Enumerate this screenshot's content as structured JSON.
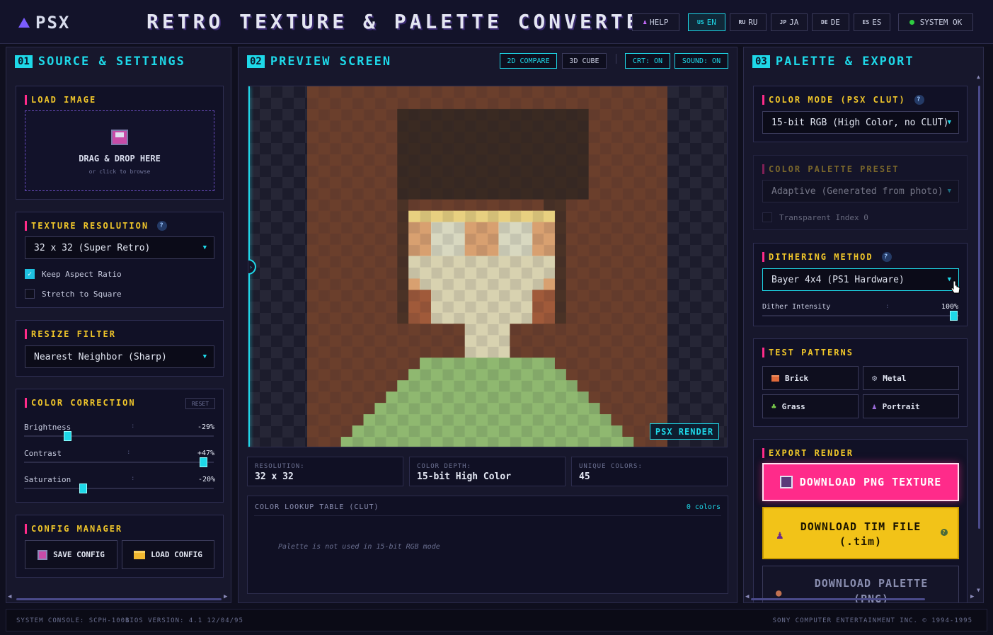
{
  "header": {
    "logo": "PSX",
    "title": "RETRO TEXTURE & PALETTE CONVERTER",
    "help": "HELP",
    "languages": [
      {
        "flag": "US",
        "label": "EN",
        "active": true
      },
      {
        "flag": "RU",
        "label": "RU",
        "active": false
      },
      {
        "flag": "JP",
        "label": "JA",
        "active": false
      },
      {
        "flag": "DE",
        "label": "DE",
        "active": false
      },
      {
        "flag": "ES",
        "label": "ES",
        "active": false
      }
    ],
    "status": "SYSTEM OK"
  },
  "source": {
    "num": "01",
    "title": "SOURCE & SETTINGS",
    "load": {
      "title": "LOAD IMAGE",
      "drop": "DRAG & DROP HERE",
      "hint": "or click to browse"
    },
    "resolution": {
      "title": "TEXTURE RESOLUTION",
      "value": "32 x 32 (Super Retro)",
      "keep_aspect": "Keep Aspect Ratio",
      "keep_aspect_checked": true,
      "stretch": "Stretch to Square",
      "stretch_checked": false
    },
    "filter": {
      "title": "RESIZE FILTER",
      "value": "Nearest Neighbor (Sharp)"
    },
    "correction": {
      "title": "COLOR CORRECTION",
      "reset": "RESET",
      "sliders": [
        {
          "label": "Brightness",
          "sep": ":",
          "value": "-29%",
          "level": -0.29
        },
        {
          "label": "Contrast",
          "sep": ":",
          "value": "+47%",
          "level": 0.47
        },
        {
          "label": "Saturation",
          "sep": ":",
          "value": "-20%",
          "level": -0.2
        }
      ]
    },
    "config": {
      "title": "CONFIG MANAGER",
      "save": "SAVE CONFIG",
      "load": "LOAD CONFIG"
    }
  },
  "preview": {
    "num": "02",
    "title": "PREVIEW SCREEN",
    "buttons": {
      "compare": "2D COMPARE",
      "cube": "3D CUBE",
      "crt": "CRT: ON",
      "sound": "SOUND: ON"
    },
    "badge": "PSX RENDER",
    "stats": [
      {
        "key": "RESOLUTION:",
        "value": "32 x 32"
      },
      {
        "key": "COLOR DEPTH:",
        "value": "15-bit High Color"
      },
      {
        "key": "UNIQUE COLORS:",
        "value": "45"
      }
    ],
    "clut": {
      "title": "COLOR LOOKUP TABLE (CLUT)",
      "count": "0 colors",
      "note": "Palette is not used in 15-bit RGB mode"
    }
  },
  "palette": {
    "num": "03",
    "title": "PALETTE & EXPORT",
    "mode": {
      "title": "COLOR MODE (PSX CLUT)",
      "value": "15-bit RGB (High Color, no CLUT)"
    },
    "preset": {
      "title": "COLOR PALETTE PRESET",
      "value": "Adaptive (Generated from photo)",
      "transparent": "Transparent Index 0"
    },
    "dither": {
      "title": "DITHERING METHOD",
      "value": "Bayer 4x4 (PS1 Hardware)",
      "intensity_label": "Dither Intensity",
      "sep": ":",
      "intensity": "100%",
      "level": 1.0
    },
    "patterns": {
      "title": "TEST PATTERNS",
      "items": [
        {
          "label": "Brick",
          "icon": "brick-icon"
        },
        {
          "label": "Metal",
          "icon": "gear-icon"
        },
        {
          "label": "Grass",
          "icon": "grass-icon"
        },
        {
          "label": "Portrait",
          "icon": "person-icon"
        }
      ]
    },
    "export": {
      "title": "EXPORT RENDER",
      "png": "DOWNLOAD PNG TEXTURE",
      "tim": "DOWNLOAD TIM FILE",
      "tim_sub": "(.tim)",
      "palette": "DOWNLOAD PALETTE",
      "palette_sub": "(PNG)"
    }
  },
  "footer": {
    "console": "SYSTEM CONSOLE: SCPH-1001",
    "bios": "BIOS VERSION: 4.1 12/04/95",
    "copyright": "SONY COMPUTER ENTERTAINMENT INC. © 1994-1995"
  },
  "colors": {
    "accent": "#1ed8e8",
    "title": "#f0c62a",
    "magenta": "#ff2b8a",
    "hair": "#6b3f2c",
    "skin": "#d8a070",
    "beard": "#d8d2b0",
    "shirt": "#8fb870"
  }
}
